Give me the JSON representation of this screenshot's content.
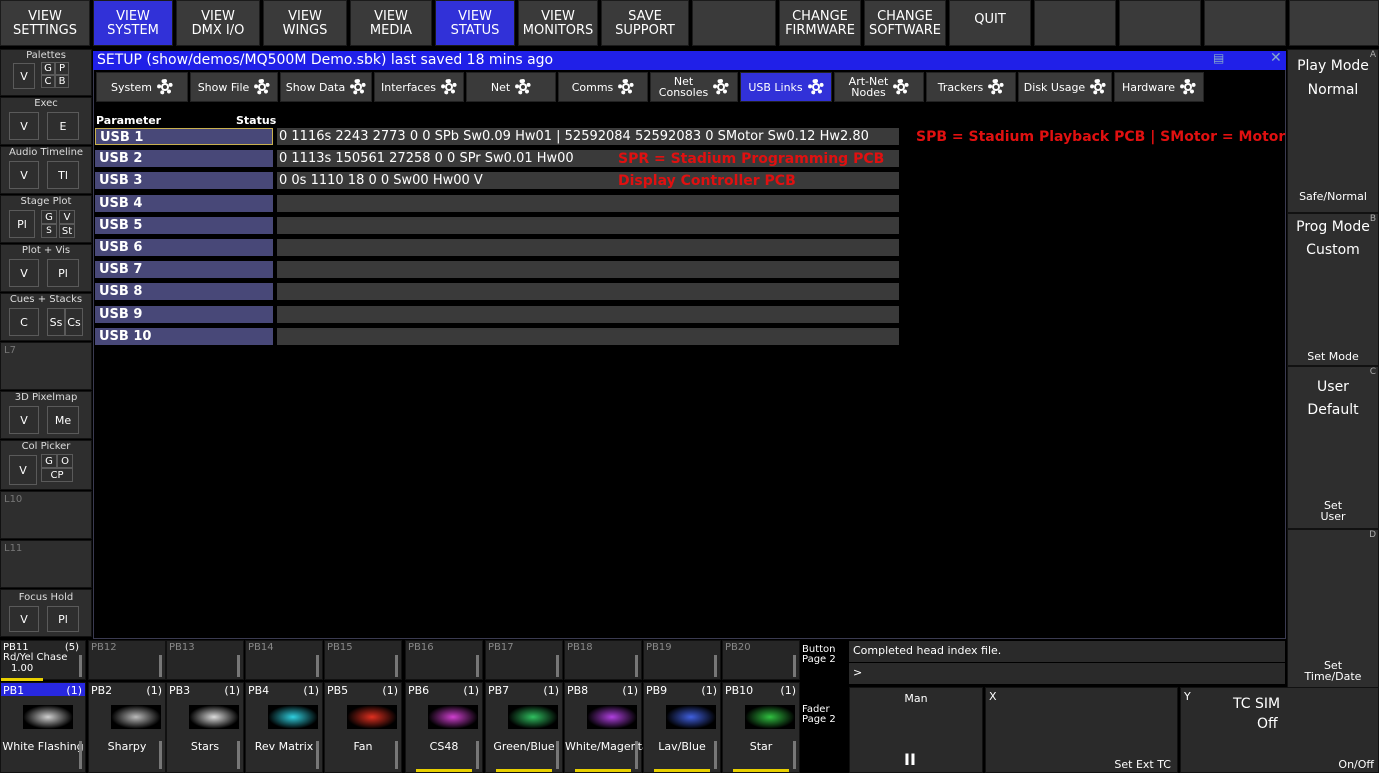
{
  "top_bar": [
    "VIEW\nSETTINGS",
    "VIEW\nSYSTEM",
    "VIEW\nDMX I/O",
    "VIEW\nWINGS",
    "VIEW\nMEDIA",
    "VIEW\nSTATUS",
    "VIEW\nMONITORS",
    "SAVE\nSUPPORT",
    "",
    "CHANGE\nFIRMWARE",
    "CHANGE\nSOFTWARE",
    "QUIT"
  ],
  "left_panel": {
    "palettes": {
      "title": "Palettes",
      "v": "V",
      "g": "G",
      "p": "P",
      "c": "C",
      "b": "B"
    },
    "exec": {
      "title": "Exec",
      "v": "V",
      "e": "E"
    },
    "audio": {
      "title": "Audio Timeline",
      "v": "V",
      "tl": "Tl"
    },
    "stage": {
      "title": "Stage Plot",
      "pl": "Pl",
      "g": "G",
      "v": "V",
      "st": "St",
      "s1": "S",
      "s2": "S"
    },
    "plotvis": {
      "title": "Plot + Vis",
      "v": "V",
      "pl": "Pl"
    },
    "cues": {
      "title": "Cues + Stacks",
      "c": "C",
      "ss": "Ss",
      "cs": "Cs"
    },
    "l7": "L7",
    "pixelmap": {
      "title": "3D Pixelmap",
      "v": "V",
      "me": "Me"
    },
    "colpicker": {
      "title": "Col Picker",
      "v": "V",
      "g": "G",
      "o": "O",
      "cp": "CP"
    },
    "l10": "L10",
    "l11": "L11",
    "focus": {
      "title": "Focus Hold",
      "v": "V",
      "pl": "Pl"
    }
  },
  "setup": {
    "title": "SETUP (show/demos/MQ500M Demo.sbk) last saved 18 mins ago"
  },
  "tabs": [
    "System",
    "Show File",
    "Show Data",
    "Interfaces",
    "Net",
    "Comms",
    "Net\nConsoles",
    "USB Links",
    "Art-Net\nNodes",
    "Trackers",
    "Disk Usage",
    "Hardware"
  ],
  "table": {
    "col_param": "Parameter",
    "col_status": "Status",
    "rows": [
      {
        "label": "USB 1",
        "value": "0 1116s 2243 2773 0 0 SPb Sw0.09 Hw01 | 52592084 52592083 0 SMotor Sw0.12 Hw2.80"
      },
      {
        "label": "USB 2",
        "value": "0 1113s 150561 27258 0 0 SPr Sw0.01 Hw00"
      },
      {
        "label": "USB 3",
        "value": "0 0s 1110 18 0 0 Sw00 Hw00 V"
      },
      {
        "label": "USB 4",
        "value": ""
      },
      {
        "label": "USB 5",
        "value": ""
      },
      {
        "label": "USB 6",
        "value": ""
      },
      {
        "label": "USB 7",
        "value": ""
      },
      {
        "label": "USB 8",
        "value": ""
      },
      {
        "label": "USB 9",
        "value": ""
      },
      {
        "label": "USB 10",
        "value": ""
      }
    ]
  },
  "annotations": {
    "a1": "SPB = Stadium Playback PCB | SMotor = Motor PCB",
    "a2": "SPR = Stadium Programming PCB",
    "a3": "Display Controller PCB"
  },
  "right_panel": {
    "play": {
      "title": "Play Mode",
      "value": "Normal",
      "bottom": "Safe/Normal",
      "key": "A"
    },
    "prog": {
      "title": "Prog Mode",
      "value": "Custom",
      "bottom": "Set Mode",
      "key": "B"
    },
    "user": {
      "title": "User",
      "value": "Default",
      "bottom": "Set\nUser",
      "key": "C"
    },
    "d": {
      "bottom": "Set\nTime/Date",
      "key": "D"
    }
  },
  "pb_top": [
    {
      "num": "PB11",
      "cnt": "(5)",
      "name": "Rd/Yel Chase",
      "val": "1.00"
    },
    {
      "num": "PB12"
    },
    {
      "num": "PB13"
    },
    {
      "num": "PB14"
    },
    {
      "num": "PB15"
    },
    {
      "num": "PB16"
    },
    {
      "num": "PB17"
    },
    {
      "num": "PB18"
    },
    {
      "num": "PB19"
    },
    {
      "num": "PB20"
    }
  ],
  "pb_bottom": [
    {
      "num": "PB1",
      "cnt": "(1)",
      "label": "White Flashing",
      "color": "#d0d0d0"
    },
    {
      "num": "PB2",
      "cnt": "(1)",
      "label": "Sharpy",
      "color": "#bbbbbb"
    },
    {
      "num": "PB3",
      "cnt": "(1)",
      "label": "Stars",
      "color": "#dddddd"
    },
    {
      "num": "PB4",
      "cnt": "(1)",
      "label": "Rev Matrix",
      "color": "#30d0e0"
    },
    {
      "num": "PB5",
      "cnt": "(1)",
      "label": "Fan",
      "color": "#e03020"
    },
    {
      "num": "PB6",
      "cnt": "(1)",
      "label": "CS48",
      "color": "#d040d0"
    },
    {
      "num": "PB7",
      "cnt": "(1)",
      "label": "Green/Blue",
      "color": "#30c060"
    },
    {
      "num": "PB8",
      "cnt": "(1)",
      "label": "White/Magenta",
      "color": "#b040e0"
    },
    {
      "num": "PB9",
      "cnt": "(1)",
      "label": "Lav/Blue",
      "color": "#4060e0"
    },
    {
      "num": "PB10",
      "cnt": "(1)",
      "label": "Star",
      "color": "#30c040"
    }
  ],
  "button_page": "Button\nPage 2",
  "fader_page": "Fader\nPage 2",
  "status_msg": "Completed head index file.",
  "cmd_prompt": ">",
  "bottom_right": {
    "man": "Man",
    "x": "X",
    "y": "Y",
    "tc_title": "TC SIM",
    "tc_value": "Off",
    "set_ext": "Set Ext TC",
    "onoff": "On/Off",
    "pause": "II"
  }
}
